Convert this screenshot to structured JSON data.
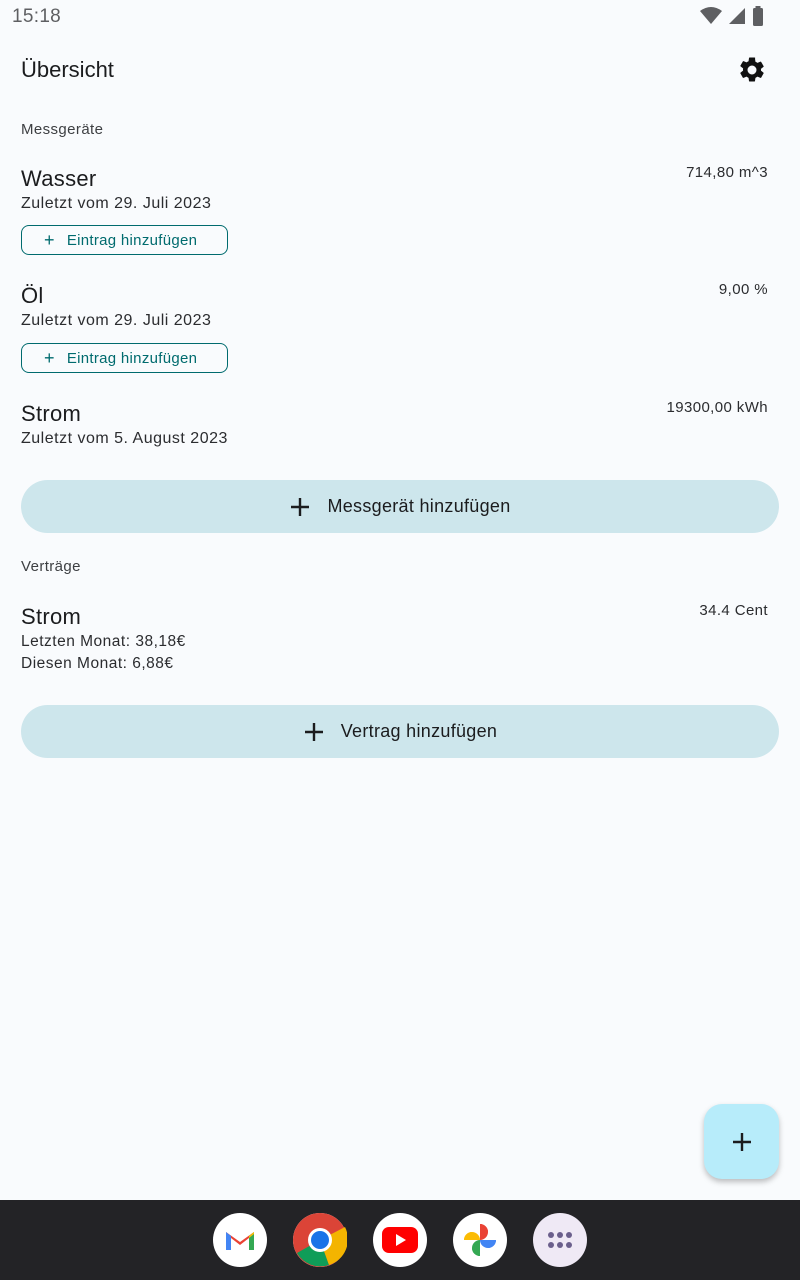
{
  "status_bar": {
    "time": "15:18"
  },
  "header": {
    "title": "Übersicht",
    "settings_icon": "gear-icon"
  },
  "meters": {
    "section_label": "Messgeräte",
    "items": [
      {
        "name": "Wasser",
        "last": "Zuletzt vom 29. Juli 2023",
        "value": "714,80 m^3",
        "add_entry_label": "Eintrag hinzufügen"
      },
      {
        "name": "Öl",
        "last": "Zuletzt vom 29. Juli 2023",
        "value": "9,00 %",
        "add_entry_label": "Eintrag hinzufügen"
      },
      {
        "name": "Strom",
        "last": "Zuletzt vom 5. August 2023",
        "value": "19300,00 kWh"
      }
    ],
    "add_button_label": "Messgerät hinzufügen"
  },
  "contracts": {
    "section_label": "Verträge",
    "items": [
      {
        "name": "Strom",
        "last_month": "Letzten Monat: 38,18€",
        "this_month": "Diesen Monat: 6,88€",
        "value": "34.4 Cent"
      }
    ],
    "add_button_label": "Vertrag hinzufügen"
  },
  "fab": {
    "icon": "plus-icon"
  },
  "dock": {
    "apps": [
      "gmail-icon",
      "chrome-icon",
      "youtube-icon",
      "photos-icon",
      "app-drawer-icon"
    ]
  },
  "colors": {
    "background": "#f9fbfd",
    "accent": "#006b6e",
    "tonal_button": "#cde6ec",
    "fab": "#b7ecfa",
    "dock": "#232326"
  }
}
